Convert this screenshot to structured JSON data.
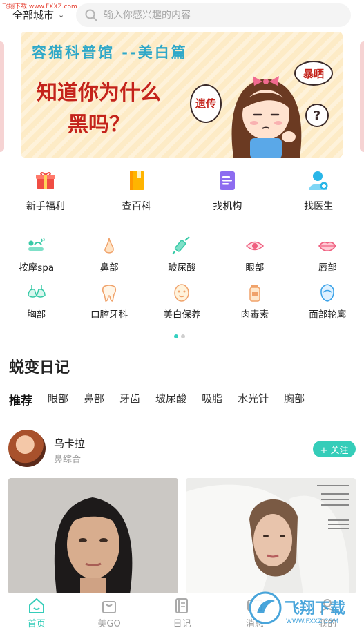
{
  "header": {
    "site_tag": "飞翔下载 www.FXXZ.com",
    "city": "全部城市",
    "search_placeholder": "输入你感兴趣的内容"
  },
  "banner": {
    "series": "容猫科普馆 --美白篇",
    "headline": "知道你为什么黑吗？",
    "bubble_rumor": "遗传",
    "bubble_sun": "暴晒",
    "bubble_q": "?"
  },
  "quick_menu": [
    {
      "label": "新手福利",
      "icon": "gift-icon"
    },
    {
      "label": "查百科",
      "icon": "book-icon"
    },
    {
      "label": "找机构",
      "icon": "document-icon"
    },
    {
      "label": "找医生",
      "icon": "doctor-icon"
    }
  ],
  "categories": [
    {
      "label": "按摩spa",
      "icon": "massage-icon"
    },
    {
      "label": "鼻部",
      "icon": "nose-icon"
    },
    {
      "label": "玻尿酸",
      "icon": "syringe-icon"
    },
    {
      "label": "眼部",
      "icon": "eye-icon"
    },
    {
      "label": "唇部",
      "icon": "lips-icon"
    },
    {
      "label": "胸部",
      "icon": "bra-icon"
    },
    {
      "label": "口腔牙科",
      "icon": "tooth-icon"
    },
    {
      "label": "美白保养",
      "icon": "face-mask-icon"
    },
    {
      "label": "肉毒素",
      "icon": "vial-icon"
    },
    {
      "label": "面部轮廓",
      "icon": "face-contour-icon"
    }
  ],
  "pager": {
    "pages": 2,
    "active": 1
  },
  "diary": {
    "title": "蜕变日记",
    "tabs": [
      "推荐",
      "眼部",
      "鼻部",
      "牙齿",
      "玻尿酸",
      "吸脂",
      "水光针",
      "胸部"
    ],
    "active_tab": 0,
    "post": {
      "user": "乌卡拉",
      "subtitle": "鼻综合",
      "follow_label": "+ 关注"
    }
  },
  "bottom_nav": [
    {
      "label": "首页",
      "icon": "home-icon",
      "active": true
    },
    {
      "label": "美GO",
      "icon": "shopping-bag-icon",
      "active": false
    },
    {
      "label": "日记",
      "icon": "notebook-icon",
      "active": false
    },
    {
      "label": "消息",
      "icon": "message-icon",
      "active": false
    },
    {
      "label": "我的",
      "icon": "profile-icon",
      "active": false
    }
  ],
  "watermark": "飞翔下载",
  "colors": {
    "accent": "#35cdb9",
    "banner_bg": "#fdebc6",
    "banner_series": "#2fa8c8",
    "banner_headline": "#c4231b",
    "gift": "#f04d43",
    "book": "#ffb400",
    "doc": "#8d6cf0",
    "doctor": "#29b6e8"
  }
}
